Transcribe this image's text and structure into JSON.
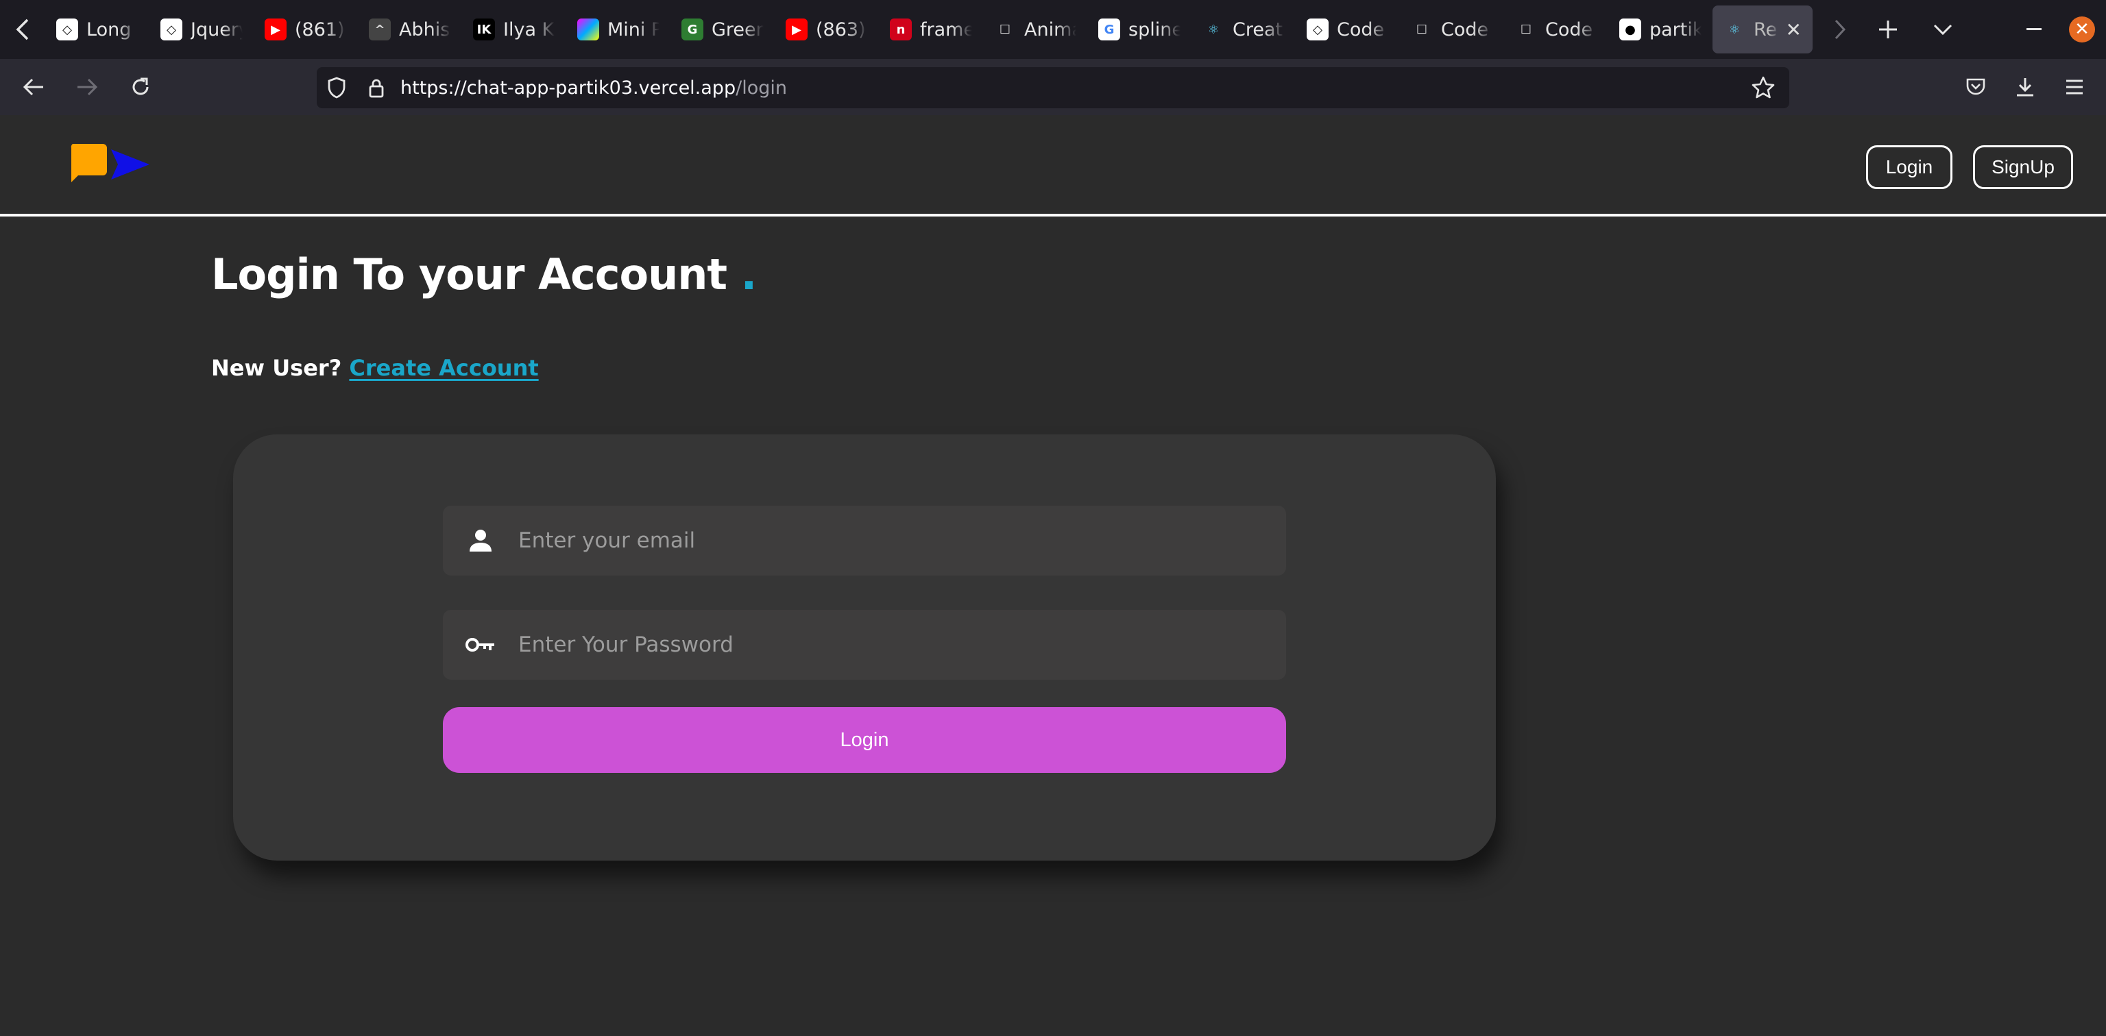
{
  "browser": {
    "tabs": [
      {
        "title": "Long",
        "favicon": "codepen-icon"
      },
      {
        "title": "Jquery",
        "favicon": "codepen-icon"
      },
      {
        "title": "(861)",
        "favicon": "youtube-icon"
      },
      {
        "title": "Abhis",
        "favicon": "circle-icon"
      },
      {
        "title": "Ilya K",
        "favicon": "ik-icon"
      },
      {
        "title": "Mini P",
        "favicon": "gradient-icon"
      },
      {
        "title": "Green",
        "favicon": "green-icon"
      },
      {
        "title": "(863)",
        "favicon": "youtube-icon"
      },
      {
        "title": "frame",
        "favicon": "framer-icon"
      },
      {
        "title": "Anima",
        "favicon": "blank-icon"
      },
      {
        "title": "spline",
        "favicon": "google-icon"
      },
      {
        "title": "Creat",
        "favicon": "react-icon"
      },
      {
        "title": "Code",
        "favicon": "codepen-icon"
      },
      {
        "title": "Code",
        "favicon": "blank-icon"
      },
      {
        "title": "Code",
        "favicon": "blank-icon"
      },
      {
        "title": "partik",
        "favicon": "github-icon"
      },
      {
        "title": "Re",
        "favicon": "react-icon",
        "active": true
      }
    ],
    "url_base": "https://chat-app-partik03.vercel.app",
    "url_path": "/login"
  },
  "header": {
    "login_label": "Login",
    "signup_label": "SignUp"
  },
  "main": {
    "title": "Login To your Account",
    "title_dot": ".",
    "new_user_label": "New User?",
    "create_account_link": "Create Account"
  },
  "form": {
    "email_placeholder": "Enter your email",
    "password_placeholder": "Enter Your Password",
    "login_button": "Login"
  },
  "colors": {
    "accent": "#1aa6c9",
    "button": "#cc52d6",
    "logo_bubble": "#ffa500",
    "logo_arrow": "#1010e6"
  }
}
